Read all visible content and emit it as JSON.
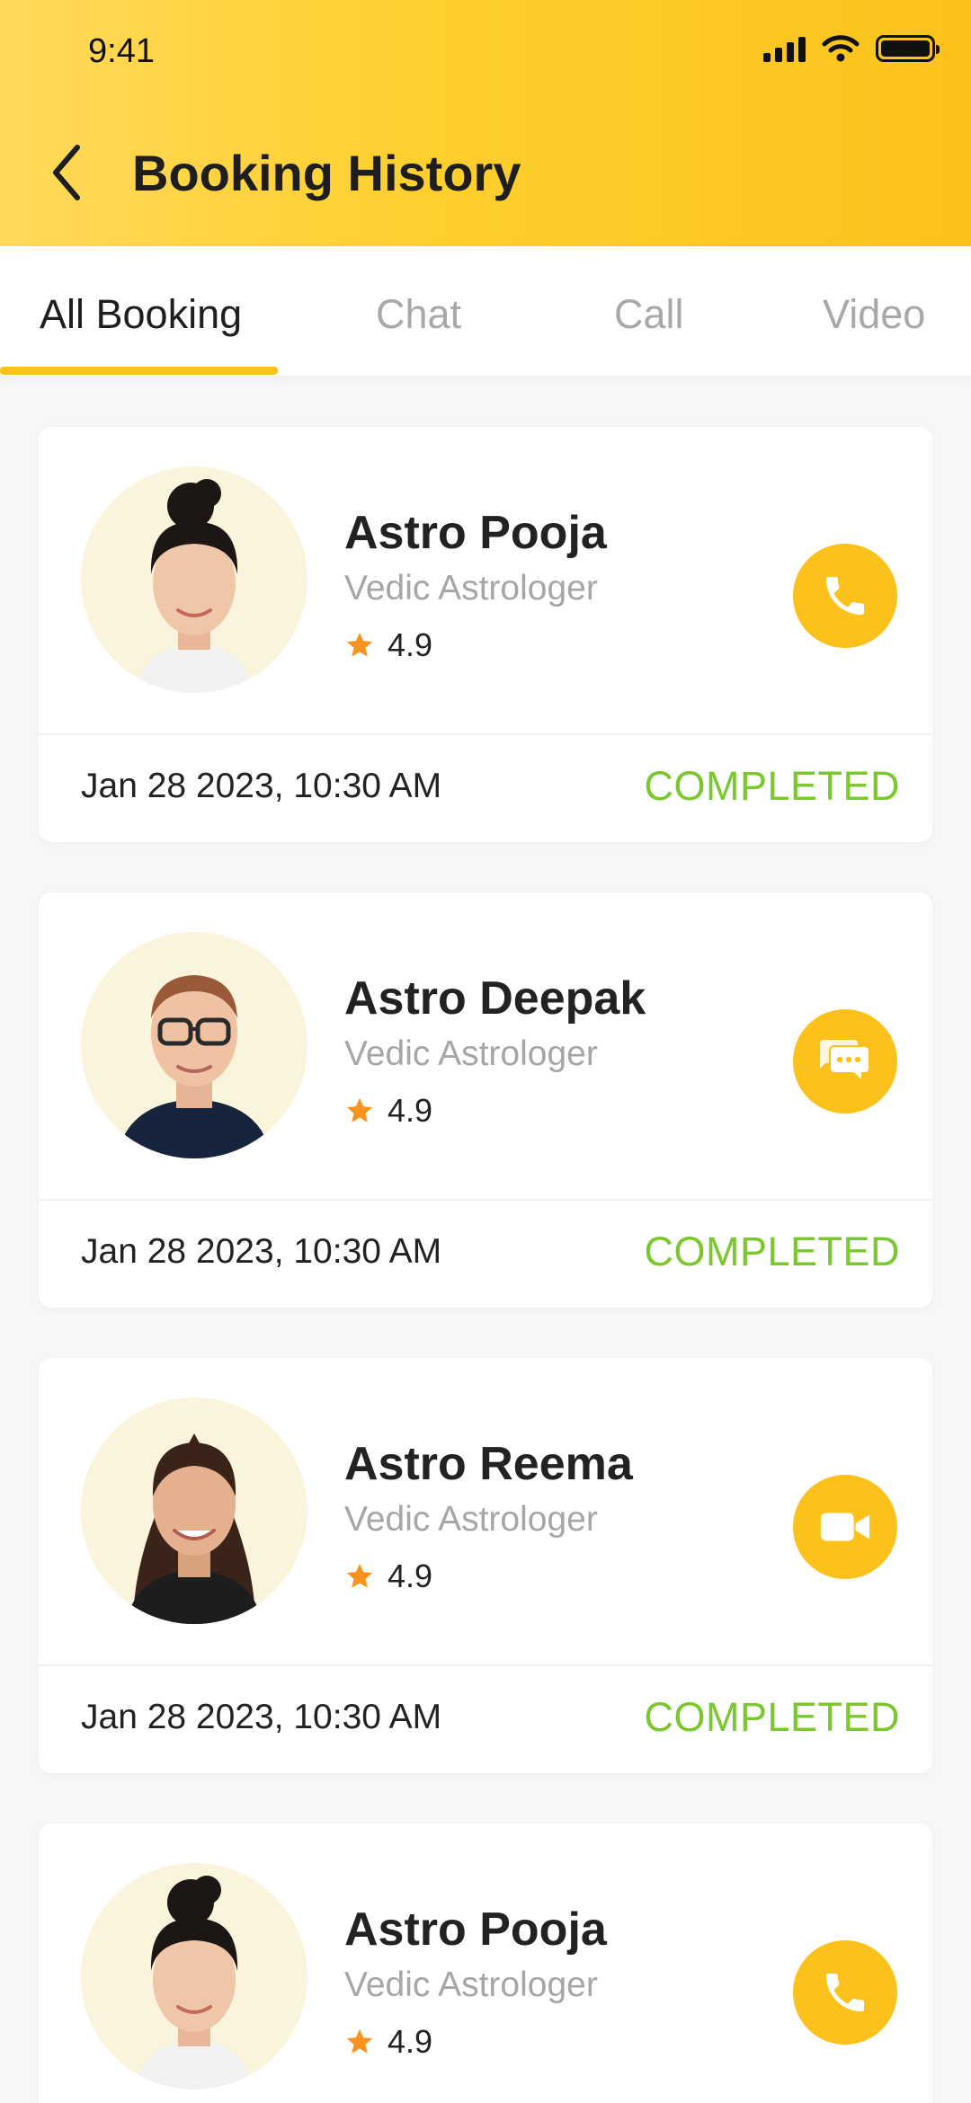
{
  "status_bar": {
    "time": "9:41"
  },
  "header": {
    "title": "Booking History"
  },
  "tabs": [
    {
      "label": "All Booking",
      "active": true
    },
    {
      "label": "Chat",
      "active": false
    },
    {
      "label": "Call",
      "active": false
    },
    {
      "label": "Video",
      "active": false
    }
  ],
  "bookings": [
    {
      "name": "Astro Pooja",
      "role": "Vedic Astrologer",
      "rating": "4.9",
      "action_icon": "phone-icon",
      "date": "Jan 28 2023, 10:30 AM",
      "status": "COMPLETED"
    },
    {
      "name": "Astro Deepak",
      "role": "Vedic Astrologer",
      "rating": "4.9",
      "action_icon": "chat-icon",
      "date": "Jan 28 2023, 10:30 AM",
      "status": "COMPLETED"
    },
    {
      "name": "Astro Reema",
      "role": "Vedic Astrologer",
      "rating": "4.9",
      "action_icon": "video-icon",
      "date": "Jan 28 2023, 10:30 AM",
      "status": "COMPLETED"
    },
    {
      "name": "Astro Pooja",
      "role": "Vedic Astrologer",
      "rating": "4.9",
      "action_icon": "phone-icon"
    }
  ],
  "colors": {
    "accent": "#fcc21b",
    "status_completed": "#7ac72e",
    "star": "#f7931e"
  }
}
